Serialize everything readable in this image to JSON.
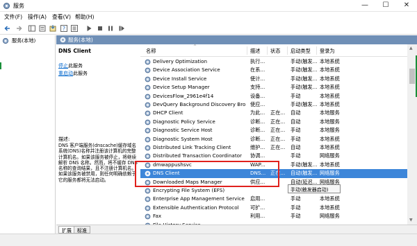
{
  "window": {
    "title": "服务",
    "minimize_glyph": "—",
    "maximize_glyph": "☐",
    "close_glyph": "✕"
  },
  "menu": {
    "items": [
      "文件(F)",
      "操作(A)",
      "查看(V)",
      "帮助(H)"
    ]
  },
  "toolbar": {
    "icons": [
      "back-icon",
      "forward-icon",
      "show-tree-icon",
      "refresh-icon",
      "export-icon",
      "help-icon",
      "properties-icon",
      "start-icon",
      "stop-icon",
      "pause-icon",
      "restart-icon"
    ]
  },
  "tree": {
    "node_label": "服务(本地)"
  },
  "panel_header": {
    "label": "服务(本地)"
  },
  "description": {
    "service_title": "DNS Client",
    "stop_link": "停止",
    "stop_suffix": "此服务",
    "restart_link": "重启动",
    "restart_suffix": "此服务",
    "desc_label": "描述:",
    "desc_text": "DNS 客户端服务(dnscache)缓存域名系统(DNS)名称并注册该计算机的完整计算机名。如果该服务被停止，将继续解析 DNS 名称。然而，将不缓存 DNS 名称的查询结果，且不注册计算机名。如果该服务被禁用，则任何明确依赖于它的服务都将无法启动。"
  },
  "list": {
    "columns": [
      "名称",
      "描述",
      "状态",
      "启动类型",
      "登录为"
    ],
    "sort_glyph": "^",
    "rows": [
      {
        "name": "Delivery Optimization",
        "desc": "执行...",
        "status": "",
        "startup": "手动(触发...",
        "logon": "本地系统",
        "selected": false
      },
      {
        "name": "Device Association Service",
        "desc": "在系...",
        "status": "",
        "startup": "手动(触发...",
        "logon": "本地系统",
        "selected": false
      },
      {
        "name": "Device Install Service",
        "desc": "使计...",
        "status": "",
        "startup": "手动(触发...",
        "logon": "本地系统",
        "selected": false
      },
      {
        "name": "Device Setup Manager",
        "desc": "支持...",
        "status": "",
        "startup": "手动(触发...",
        "logon": "本地系统",
        "selected": false
      },
      {
        "name": "DevicesFlow_2961e4f14",
        "desc": "设备...",
        "status": "",
        "startup": "手动",
        "logon": "本地系统",
        "selected": false
      },
      {
        "name": "DevQuery Background Discovery Bro...",
        "desc": "使应...",
        "status": "",
        "startup": "手动(触发...",
        "logon": "本地系统",
        "selected": false
      },
      {
        "name": "DHCP Client",
        "desc": "为此...",
        "status": "正在...",
        "startup": "自动",
        "logon": "本地服务",
        "selected": false
      },
      {
        "name": "Diagnostic Policy Service",
        "desc": "诊断...",
        "status": "正在...",
        "startup": "自动",
        "logon": "本地服务",
        "selected": false
      },
      {
        "name": "Diagnostic Service Host",
        "desc": "诊断...",
        "status": "正在...",
        "startup": "手动",
        "logon": "本地服务",
        "selected": false
      },
      {
        "name": "Diagnostic System Host",
        "desc": "诊断...",
        "status": "正在...",
        "startup": "手动",
        "logon": "本地系统",
        "selected": false
      },
      {
        "name": "Distributed Link Tracking Client",
        "desc": "维护...",
        "status": "正在...",
        "startup": "自动",
        "logon": "本地系统",
        "selected": false
      },
      {
        "name": "Distributed Transaction Coordinator",
        "desc": "协调...",
        "status": "",
        "startup": "手动",
        "logon": "网络服务",
        "selected": false
      },
      {
        "name": "dmwappushsvc",
        "desc": "WAP...",
        "status": "",
        "startup": "手动(触发...",
        "logon": "本地系统",
        "selected": false
      },
      {
        "name": "DNS Client",
        "desc": "DNS...",
        "status": "正在...",
        "startup": "自动(触发...",
        "logon": "网络服务",
        "selected": true
      },
      {
        "name": "Downloaded Maps Manager",
        "desc": "供应...",
        "status": "",
        "startup": "自动(延迟...",
        "logon": "网络服务",
        "selected": false
      },
      {
        "name": "Encrypting File System (EFS)",
        "desc": "",
        "status": "",
        "startup": "",
        "logon": "本地系统",
        "selected": false
      },
      {
        "name": "Enterprise App Management Service",
        "desc": "启用...",
        "status": "",
        "startup": "手动",
        "logon": "本地系统",
        "selected": false
      },
      {
        "name": "Extensible Authentication Protocol",
        "desc": "可扩...",
        "status": "",
        "startup": "手动",
        "logon": "本地系统",
        "selected": false
      },
      {
        "name": "Fax",
        "desc": "利用...",
        "status": "",
        "startup": "手动",
        "logon": "网络服务",
        "selected": false
      },
      {
        "name": "File History Service",
        "desc": "",
        "status": "",
        "startup": "",
        "logon": "",
        "selected": false
      }
    ]
  },
  "tooltip": {
    "text": "手动(触发器启动)"
  },
  "tabs": [
    "扩展",
    "标准"
  ],
  "colors": {
    "selection": "#3d86d9",
    "header_bar": "#6f8fb6",
    "link": "#0066cc",
    "highlight_box": "#e0201c"
  }
}
